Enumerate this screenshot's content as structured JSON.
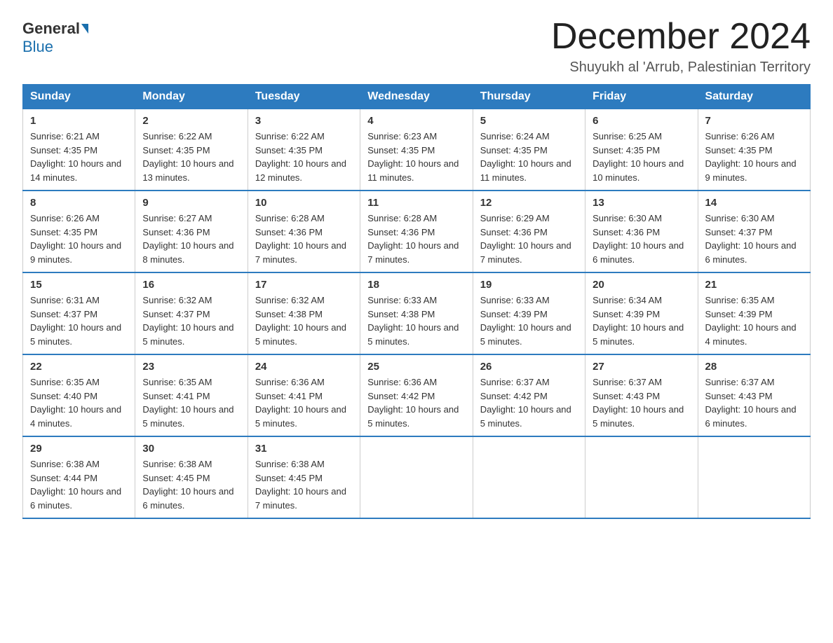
{
  "header": {
    "logo_general": "General",
    "logo_blue": "Blue",
    "month_title": "December 2024",
    "location": "Shuyukh al 'Arrub, Palestinian Territory"
  },
  "days_of_week": [
    "Sunday",
    "Monday",
    "Tuesday",
    "Wednesday",
    "Thursday",
    "Friday",
    "Saturday"
  ],
  "weeks": [
    [
      {
        "day": "1",
        "sunrise": "6:21 AM",
        "sunset": "4:35 PM",
        "daylight": "10 hours and 14 minutes."
      },
      {
        "day": "2",
        "sunrise": "6:22 AM",
        "sunset": "4:35 PM",
        "daylight": "10 hours and 13 minutes."
      },
      {
        "day": "3",
        "sunrise": "6:22 AM",
        "sunset": "4:35 PM",
        "daylight": "10 hours and 12 minutes."
      },
      {
        "day": "4",
        "sunrise": "6:23 AM",
        "sunset": "4:35 PM",
        "daylight": "10 hours and 11 minutes."
      },
      {
        "day": "5",
        "sunrise": "6:24 AM",
        "sunset": "4:35 PM",
        "daylight": "10 hours and 11 minutes."
      },
      {
        "day": "6",
        "sunrise": "6:25 AM",
        "sunset": "4:35 PM",
        "daylight": "10 hours and 10 minutes."
      },
      {
        "day": "7",
        "sunrise": "6:26 AM",
        "sunset": "4:35 PM",
        "daylight": "10 hours and 9 minutes."
      }
    ],
    [
      {
        "day": "8",
        "sunrise": "6:26 AM",
        "sunset": "4:35 PM",
        "daylight": "10 hours and 9 minutes."
      },
      {
        "day": "9",
        "sunrise": "6:27 AM",
        "sunset": "4:36 PM",
        "daylight": "10 hours and 8 minutes."
      },
      {
        "day": "10",
        "sunrise": "6:28 AM",
        "sunset": "4:36 PM",
        "daylight": "10 hours and 7 minutes."
      },
      {
        "day": "11",
        "sunrise": "6:28 AM",
        "sunset": "4:36 PM",
        "daylight": "10 hours and 7 minutes."
      },
      {
        "day": "12",
        "sunrise": "6:29 AM",
        "sunset": "4:36 PM",
        "daylight": "10 hours and 7 minutes."
      },
      {
        "day": "13",
        "sunrise": "6:30 AM",
        "sunset": "4:36 PM",
        "daylight": "10 hours and 6 minutes."
      },
      {
        "day": "14",
        "sunrise": "6:30 AM",
        "sunset": "4:37 PM",
        "daylight": "10 hours and 6 minutes."
      }
    ],
    [
      {
        "day": "15",
        "sunrise": "6:31 AM",
        "sunset": "4:37 PM",
        "daylight": "10 hours and 5 minutes."
      },
      {
        "day": "16",
        "sunrise": "6:32 AM",
        "sunset": "4:37 PM",
        "daylight": "10 hours and 5 minutes."
      },
      {
        "day": "17",
        "sunrise": "6:32 AM",
        "sunset": "4:38 PM",
        "daylight": "10 hours and 5 minutes."
      },
      {
        "day": "18",
        "sunrise": "6:33 AM",
        "sunset": "4:38 PM",
        "daylight": "10 hours and 5 minutes."
      },
      {
        "day": "19",
        "sunrise": "6:33 AM",
        "sunset": "4:39 PM",
        "daylight": "10 hours and 5 minutes."
      },
      {
        "day": "20",
        "sunrise": "6:34 AM",
        "sunset": "4:39 PM",
        "daylight": "10 hours and 5 minutes."
      },
      {
        "day": "21",
        "sunrise": "6:35 AM",
        "sunset": "4:39 PM",
        "daylight": "10 hours and 4 minutes."
      }
    ],
    [
      {
        "day": "22",
        "sunrise": "6:35 AM",
        "sunset": "4:40 PM",
        "daylight": "10 hours and 4 minutes."
      },
      {
        "day": "23",
        "sunrise": "6:35 AM",
        "sunset": "4:41 PM",
        "daylight": "10 hours and 5 minutes."
      },
      {
        "day": "24",
        "sunrise": "6:36 AM",
        "sunset": "4:41 PM",
        "daylight": "10 hours and 5 minutes."
      },
      {
        "day": "25",
        "sunrise": "6:36 AM",
        "sunset": "4:42 PM",
        "daylight": "10 hours and 5 minutes."
      },
      {
        "day": "26",
        "sunrise": "6:37 AM",
        "sunset": "4:42 PM",
        "daylight": "10 hours and 5 minutes."
      },
      {
        "day": "27",
        "sunrise": "6:37 AM",
        "sunset": "4:43 PM",
        "daylight": "10 hours and 5 minutes."
      },
      {
        "day": "28",
        "sunrise": "6:37 AM",
        "sunset": "4:43 PM",
        "daylight": "10 hours and 6 minutes."
      }
    ],
    [
      {
        "day": "29",
        "sunrise": "6:38 AM",
        "sunset": "4:44 PM",
        "daylight": "10 hours and 6 minutes."
      },
      {
        "day": "30",
        "sunrise": "6:38 AM",
        "sunset": "4:45 PM",
        "daylight": "10 hours and 6 minutes."
      },
      {
        "day": "31",
        "sunrise": "6:38 AM",
        "sunset": "4:45 PM",
        "daylight": "10 hours and 7 minutes."
      },
      null,
      null,
      null,
      null
    ]
  ]
}
